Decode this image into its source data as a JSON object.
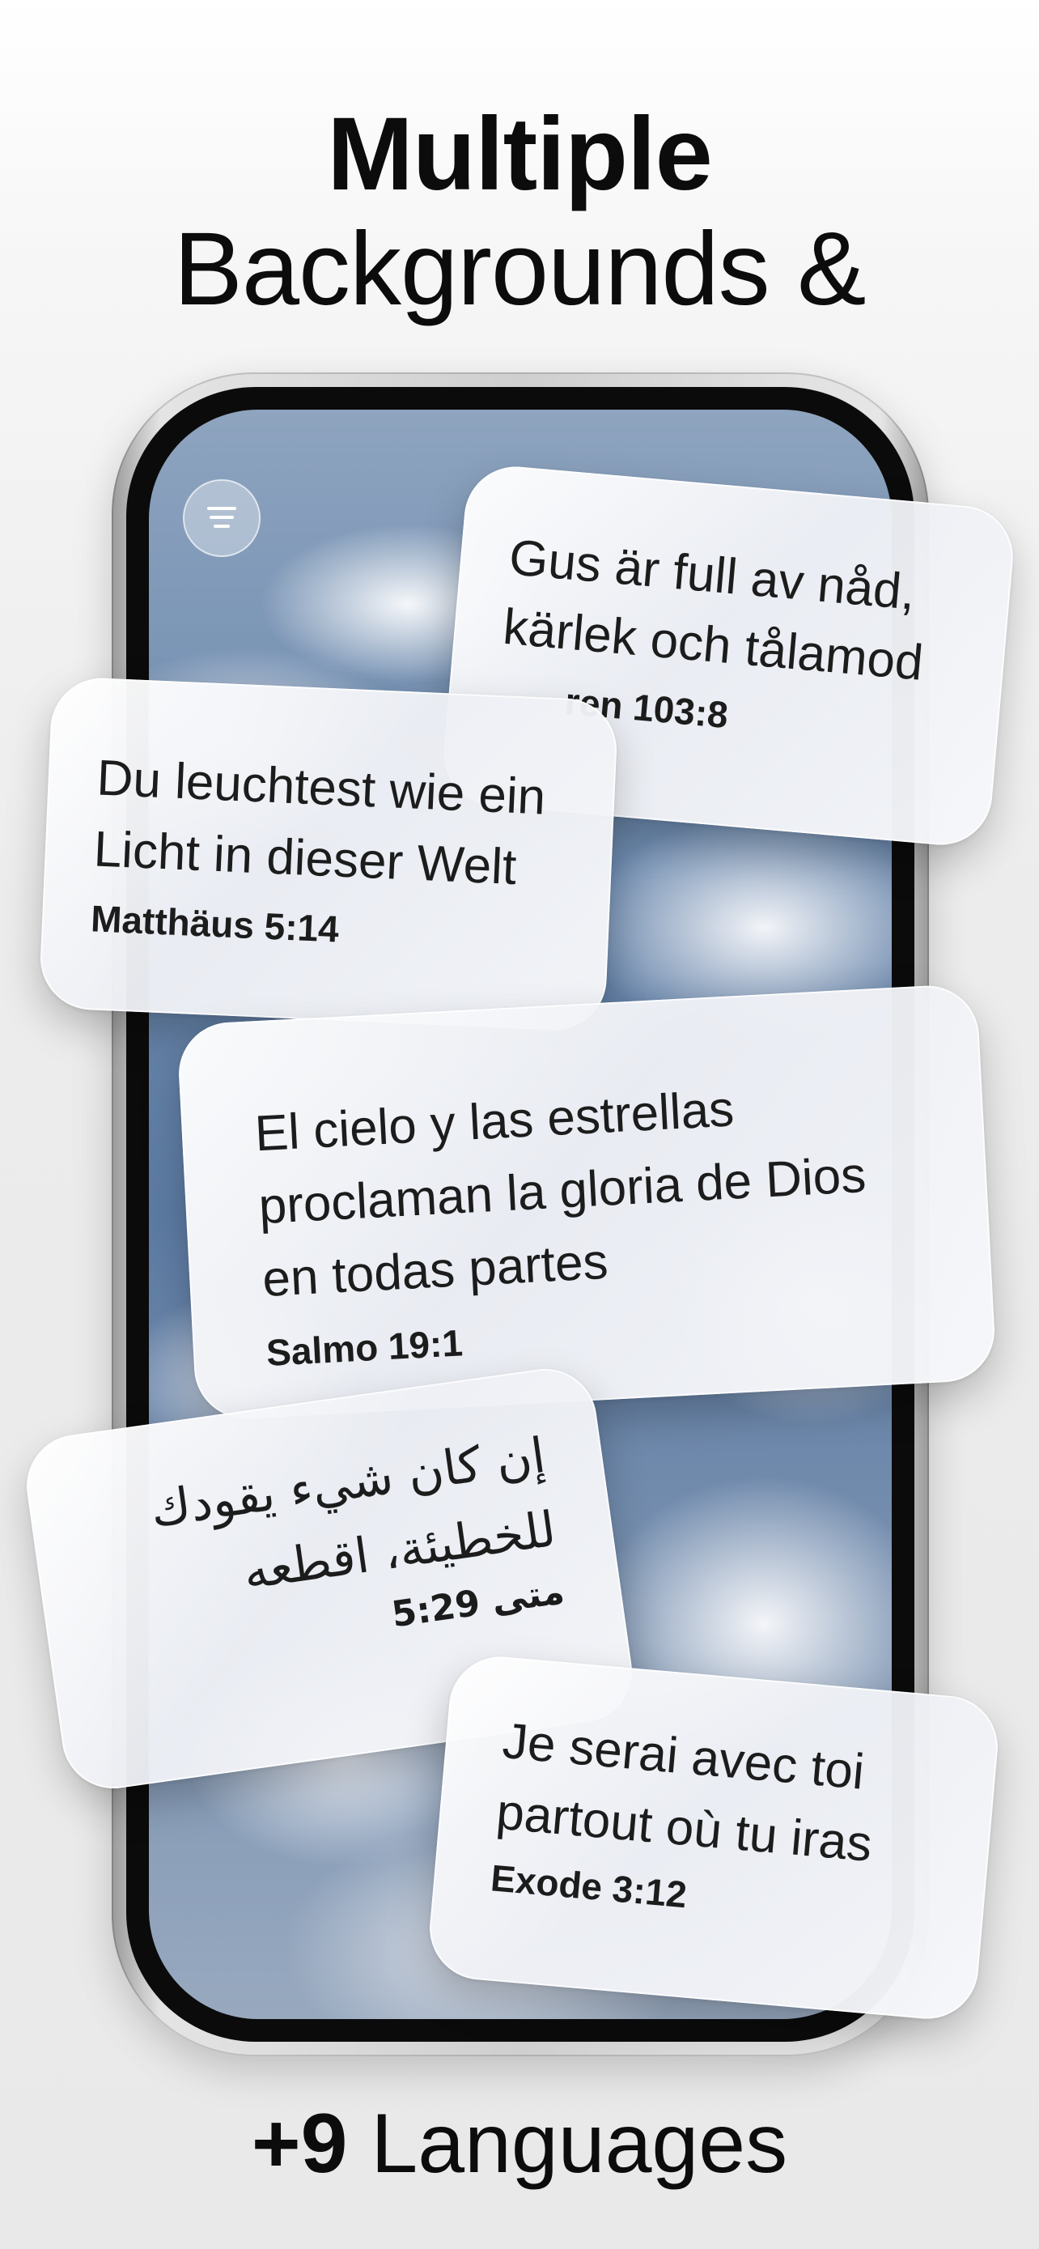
{
  "headline": {
    "line1": "Multiple",
    "line2": "Backgrounds &"
  },
  "footer": {
    "plus": "+9",
    "languages": "Languages"
  },
  "phone": {
    "menu_icon": "menu-icon"
  },
  "cards": {
    "swedish": {
      "verse_line1": "Gus är full av nåd,",
      "verse_line2": "kärlek och tålamod",
      "reference": "ren 103:8"
    },
    "german": {
      "verse_line1": "Du leuchtest wie ein",
      "verse_line2": "Licht in dieser Welt",
      "reference": "Matthäus 5:14"
    },
    "spanish": {
      "verse_line1": "El cielo y las estrellas",
      "verse_line2": "proclaman la gloria de Dios",
      "verse_line3": "en todas partes",
      "reference": "Salmo 19:1"
    },
    "arabic": {
      "verse_line1": "إن كان شيء يقودك",
      "verse_line2": "للخطيئة، اقطعه",
      "reference": "متى 5:29"
    },
    "french": {
      "verse_line1": "Je serai avec toi",
      "verse_line2": "partout où tu iras",
      "reference": "Exode 3:12"
    }
  }
}
